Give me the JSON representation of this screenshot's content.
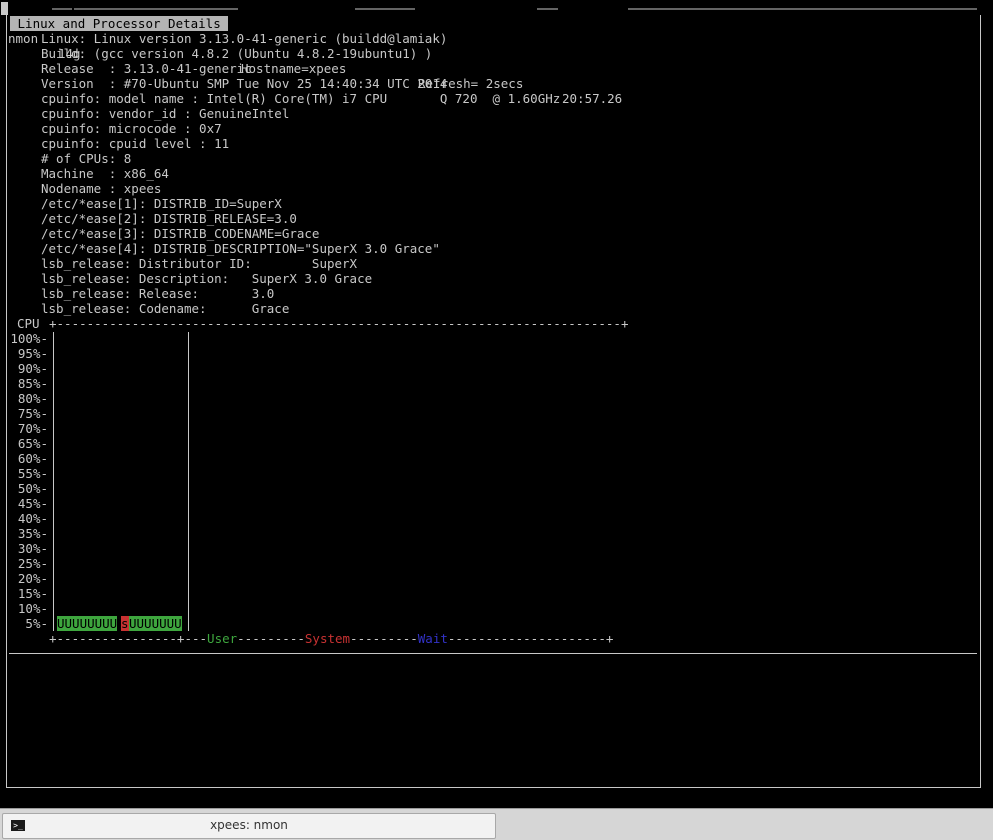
{
  "titlebar": {
    "program": "nmon",
    "version": "14g",
    "hostname": "Hostname=xpees",
    "refresh": "Refresh= 2secs",
    "time": "20:57.26"
  },
  "section_title": " Linux and Processor Details ",
  "details": [
    "Linux: Linux version 3.13.0-41-generic (buildd@lamiak)",
    "Build: (gcc version 4.8.2 (Ubuntu 4.8.2-19ubuntu1) )",
    "Release  : 3.13.0-41-generic",
    "Version  : #70-Ubuntu SMP Tue Nov 25 14:40:34 UTC 2014",
    "cpuinfo: model name : Intel(R) Core(TM) i7 CPU       Q 720  @ 1.60GHz",
    "cpuinfo: vendor_id : GenuineIntel",
    "cpuinfo: microcode : 0x7",
    "cpuinfo: cpuid level : 11",
    "# of CPUs: 8",
    "Machine  : x86_64",
    "Nodename : xpees",
    "/etc/*ease[1]: DISTRIB_ID=SuperX",
    "/etc/*ease[2]: DISTRIB_RELEASE=3.0",
    "/etc/*ease[3]: DISTRIB_CODENAME=Grace",
    "/etc/*ease[4]: DISTRIB_DESCRIPTION=\"SuperX 3.0 Grace\"",
    "lsb_release: Distributor ID:        SuperX",
    "lsb_release: Description:   SuperX 3.0 Grace",
    "lsb_release: Release:       3.0",
    "lsb_release: Codename:      Grace"
  ],
  "cpu_graph": {
    "label": "CPU",
    "top_border": "+---------------------------------------------------------------------------+",
    "y_labels": [
      "100%-",
      "95%-",
      "90%-",
      "85%-",
      "80%-",
      "75%-",
      "70%-",
      "65%-",
      "60%-",
      "55%-",
      "50%-",
      "45%-",
      "40%-",
      "35%-",
      "30%-",
      "25%-",
      "20%-",
      "15%-",
      "10%-",
      "5%-"
    ],
    "bar_user_a": "UUUUUUUU",
    "bar_sys": "s",
    "bar_user_b": "UUUUUUU",
    "bottom_prefix": "+----------------+---",
    "legend_user": "User",
    "legend_dash1": "---------",
    "legend_system": "System",
    "legend_dash2": "---------",
    "legend_wait": "Wait",
    "bottom_suffix": "---------------------+",
    "colors": {
      "user": "#3ea63e",
      "system": "#c83232",
      "wait": "#3232c8"
    }
  },
  "taskbar": {
    "window_label": "xpees: nmon",
    "icon": "terminal-icon"
  }
}
